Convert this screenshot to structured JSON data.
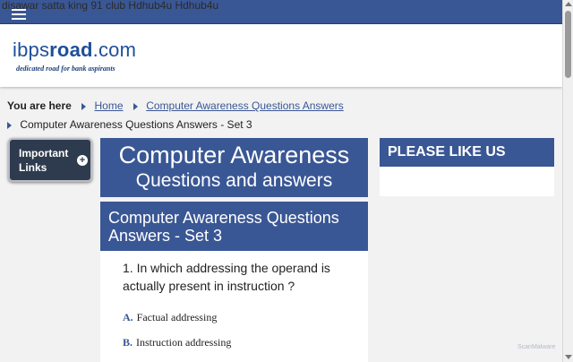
{
  "topbar": {
    "marquee_text": "disawar satta king 91 club Hdhub4u Hdhub4u",
    "bg_color": "#3a5795"
  },
  "header": {
    "logo_prefix": "ibps",
    "logo_bold": "road",
    "logo_suffix": ".com",
    "logo_tagline": "dedicated road for bank aspirants"
  },
  "breadcrumb": {
    "prefix": "You are here",
    "home": "Home",
    "category": "Computer Awareness Questions Answers",
    "current": "Computer Awareness Questions Answers - Set 3"
  },
  "sidebar": {
    "important_links_line1": "Important",
    "important_links_line2": "Links",
    "plus_symbol": "+"
  },
  "banner": {
    "line1": "Computer Awareness",
    "line2": "Questions and answers"
  },
  "article": {
    "title": "Computer Awareness Questions Answers - Set 3",
    "question": "1. In which addressing the operand is actually present in instruction ?",
    "options": [
      {
        "letter": "A.",
        "text": "Factual addressing"
      },
      {
        "letter": "B.",
        "text": "Instruction addressing"
      }
    ]
  },
  "like_box": {
    "heading": "PLEASE LIKE US"
  },
  "watermark": "ScanMalware"
}
